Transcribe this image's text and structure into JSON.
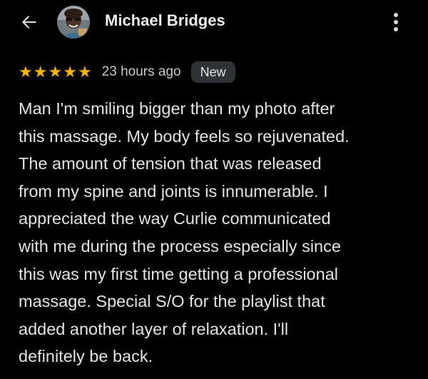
{
  "header": {
    "back_icon": "arrow-left-icon",
    "author_name": "Michael Bridges",
    "avatar_icon": "user-avatar-icon",
    "more_icon": "more-vertical-icon"
  },
  "review": {
    "rating": 5,
    "rating_max": 5,
    "star_color": "#f5b400",
    "time_ago": "23 hours ago",
    "badge": "New",
    "lines": [
      "Man I'm smiling bigger than my photo after",
      "this massage. My body feels so rejuvenated.",
      "The amount of tension that was released",
      "from my spine and joints is innumerable. I",
      "appreciated the way Curlie communicated",
      "with me during the process especially since",
      "this was my first time getting a professional",
      "massage. Special S/O for the playlist that",
      "added another layer of relaxation. I'll",
      "definitely be back."
    ]
  },
  "colors": {
    "background": "#000000",
    "text": "#e3e3e3",
    "badge_bg": "#2f3337"
  }
}
